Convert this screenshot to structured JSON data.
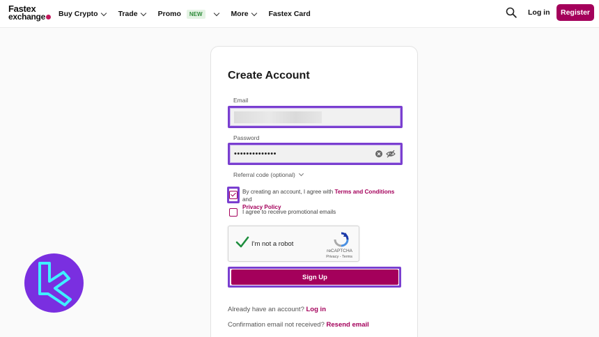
{
  "header": {
    "logo_line1": "Fastex",
    "logo_line2": "exchange",
    "nav": [
      {
        "label": "Buy Crypto",
        "has_dropdown": true
      },
      {
        "label": "Trade",
        "has_dropdown": true
      },
      {
        "label": "Promo",
        "has_dropdown": true,
        "badge": "NEW"
      },
      {
        "label": "More",
        "has_dropdown": true
      },
      {
        "label": "Fastex Card",
        "has_dropdown": false
      }
    ],
    "login_label": "Log in",
    "register_label": "Register",
    "search_icon": "search-icon"
  },
  "form": {
    "title": "Create Account",
    "email_label": "Email",
    "password_label": "Password",
    "password_value": "••••••••••••••",
    "referral_label": "Referral code (optional)",
    "terms_prefix": "By creating an account, I agree with ",
    "terms_link": "Terms and Conditions",
    "terms_and": " and",
    "privacy_link": "Privacy Policy",
    "terms_checked": true,
    "promo_label": "I agree to receive promotional emails",
    "promo_checked": false,
    "captcha_label": "I'm not a robot",
    "captcha_brand": "reCAPTCHA",
    "captcha_terms": "Privacy - Terms",
    "signup_label": "Sign Up",
    "have_account_text": "Already have an account? ",
    "login_link": "Log in",
    "confirmation_text": "Confirmation email not received? ",
    "resend_link": "Resend email"
  },
  "colors": {
    "brand": "#a4005b",
    "highlight": "#7a3fd0",
    "watermark": "#7a2fe0",
    "watermark_mark": "#3ff0ff"
  }
}
